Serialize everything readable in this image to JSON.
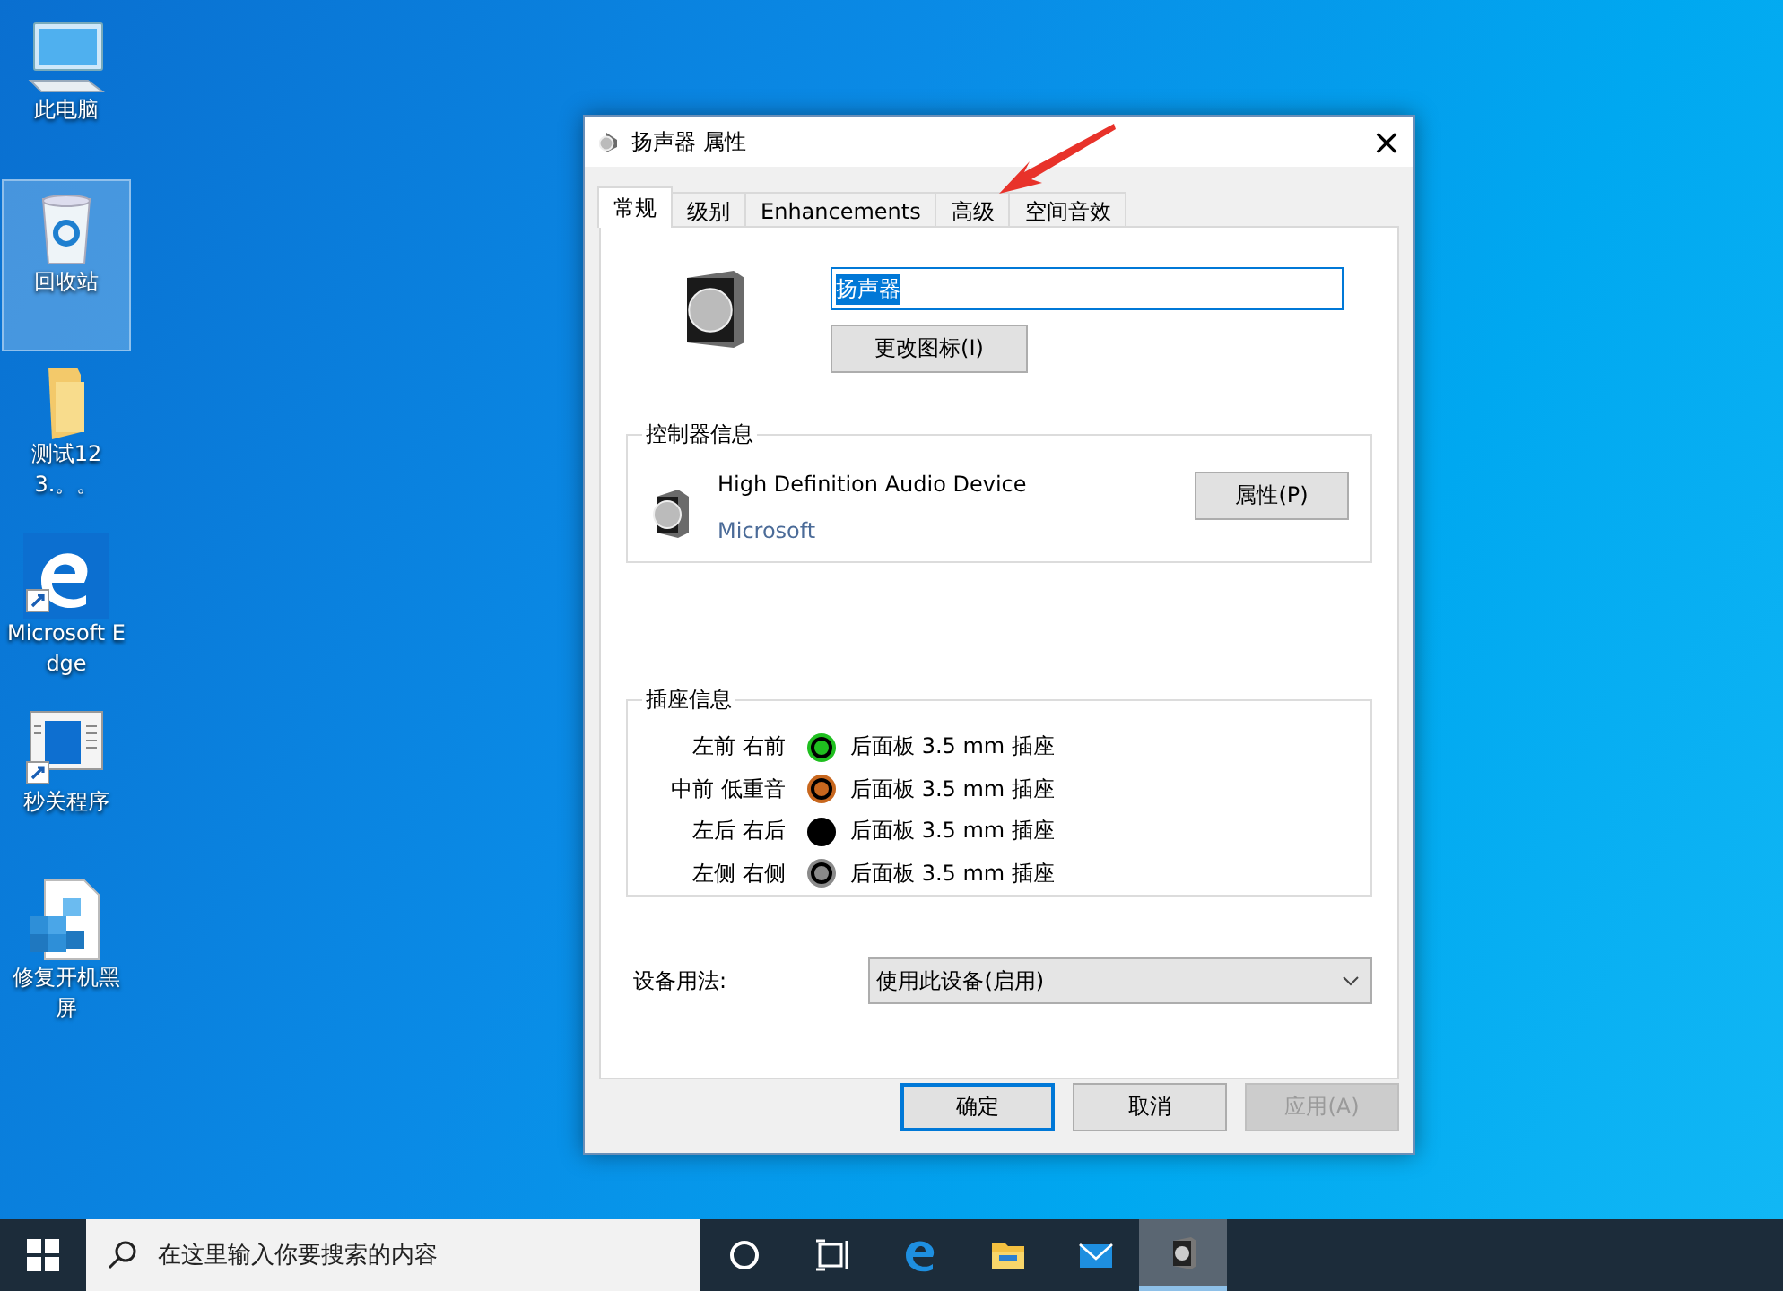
{
  "desktop_icons": [
    {
      "kind": "computer",
      "label": "此电脑",
      "selected": false
    },
    {
      "kind": "recycle",
      "label": "回收站",
      "selected": true
    },
    {
      "kind": "folder",
      "label": "测试123.。。",
      "selected": false
    },
    {
      "kind": "edge",
      "label": "Microsoft Edge",
      "selected": false
    },
    {
      "kind": "app",
      "label": "秒关程序",
      "selected": false
    },
    {
      "kind": "registry",
      "label": "修复开机黑屏",
      "selected": false
    }
  ],
  "window": {
    "title": "扬声器 属性",
    "close": "×",
    "tabs": [
      {
        "label": "常规",
        "selected": true
      },
      {
        "label": "级别",
        "selected": false
      },
      {
        "label": "Enhancements",
        "selected": false
      },
      {
        "label": "高级",
        "selected": false
      },
      {
        "label": "空间音效",
        "selected": false
      }
    ],
    "name_field": {
      "value": "扬声器"
    },
    "change_icon_button": "更改图标(I)",
    "controller": {
      "title": "控制器信息",
      "device": "High Definition Audio Device",
      "vendor": "Microsoft",
      "properties_button": "属性(P)"
    },
    "jacks": {
      "title": "插座信息",
      "items": [
        {
          "channels": "左前 右前",
          "color": "#1fbf1f",
          "description": "后面板 3.5 mm 插座"
        },
        {
          "channels": "中前 低重音",
          "color": "#c8671e",
          "description": "后面板 3.5 mm 插座"
        },
        {
          "channels": "左后 右后",
          "color": "#000000",
          "description": "后面板 3.5 mm 插座"
        },
        {
          "channels": "左侧 右侧",
          "color": "#8a8a8a",
          "description": "后面板 3.5 mm 插座"
        }
      ]
    },
    "device_usage": {
      "label": "设备用法:",
      "value": "使用此设备(启用)"
    },
    "buttons": [
      {
        "label": "确定",
        "default": true,
        "disabled": false
      },
      {
        "label": "取消",
        "default": false,
        "disabled": false
      },
      {
        "label": "应用(A)",
        "default": false,
        "disabled": true
      }
    ]
  },
  "taskbar": {
    "search": {
      "placeholder": "在这里输入你要搜索的内容"
    },
    "apps": [
      {
        "kind": "cortana",
        "active": false
      },
      {
        "kind": "taskview",
        "active": false
      },
      {
        "kind": "edge",
        "active": false
      },
      {
        "kind": "folder",
        "active": false
      },
      {
        "kind": "mail",
        "active": false
      },
      {
        "kind": "speaker",
        "active": true
      }
    ]
  }
}
